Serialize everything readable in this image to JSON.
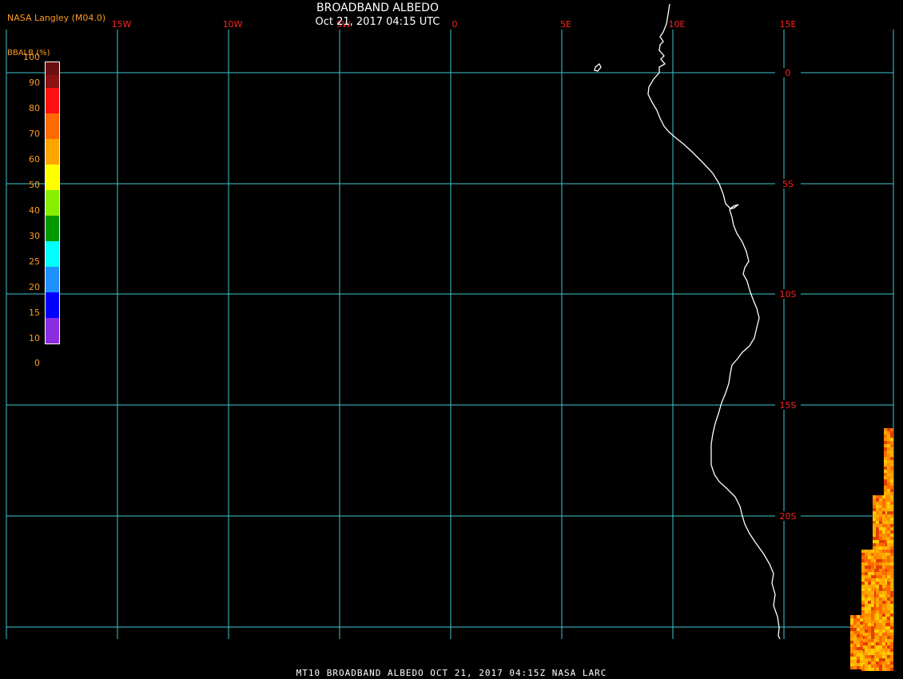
{
  "header": {
    "org_label": "NASA Langley (M04.0)",
    "title": "BROADBAND ALBEDO",
    "datetime": "Oct 21, 2017 04:15 UTC"
  },
  "footer": {
    "caption": "MT10  BROADBAND ALBEDO   OCT 21, 2017 04:15Z   NASA LARC"
  },
  "colorbar": {
    "label": "BBALB (%)",
    "ticks": [
      "100",
      "90",
      "80",
      "70",
      "60",
      "50",
      "40",
      "30",
      "25",
      "20",
      "15",
      "10",
      "0"
    ],
    "colors": [
      "#6a1010",
      "#8a1212",
      "#ff1010",
      "#ff6a00",
      "#ffa500",
      "#ffff00",
      "#88ee00",
      "#009900",
      "#00ffff",
      "#1e90ff",
      "#0000ff",
      "#8b2be2"
    ]
  },
  "map": {
    "longitude_labels": [
      "15W",
      "10W",
      "5W",
      "0",
      "5E",
      "10E",
      "15E"
    ],
    "latitude_labels": [
      "0",
      "5S",
      "10S",
      "15S",
      "20S"
    ],
    "grid_color": "#3fc8d0",
    "label_color": "#ff2020",
    "coast_color": "#ffffff"
  }
}
